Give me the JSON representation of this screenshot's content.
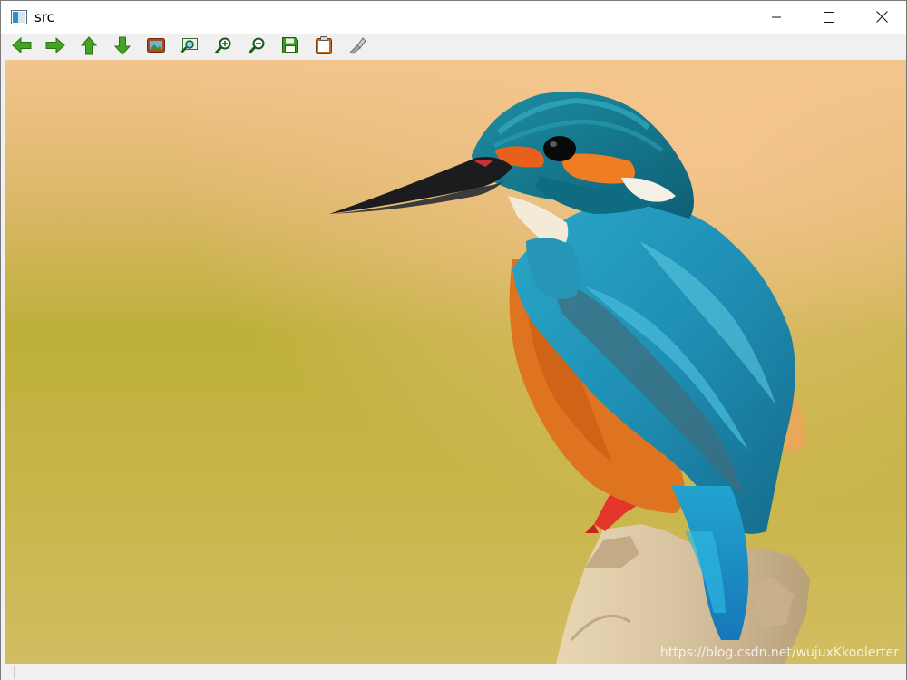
{
  "window": {
    "title": "src",
    "controls": {
      "minimize": "minimize-icon",
      "maximize": "maximize-icon",
      "close": "close-icon"
    }
  },
  "toolbar": {
    "buttons": [
      {
        "icon": "arrow-left-icon"
      },
      {
        "icon": "arrow-right-icon"
      },
      {
        "icon": "arrow-up-icon"
      },
      {
        "icon": "arrow-down-icon"
      },
      {
        "icon": "image-icon"
      },
      {
        "icon": "zoom-fit-icon"
      },
      {
        "icon": "zoom-in-icon"
      },
      {
        "icon": "zoom-out-icon"
      },
      {
        "icon": "save-icon"
      },
      {
        "icon": "clipboard-icon"
      },
      {
        "icon": "properties-icon"
      }
    ]
  },
  "image": {
    "subject": "kingfisher-photo",
    "watermark": "https://blog.csdn.net/wujuxKkoolerter"
  },
  "colors": {
    "titlebar": "#ffffff",
    "toolbar": "#f0f0f0",
    "arrow_green": "#3f9a1f",
    "bg_top": "#f2c48c",
    "bg_mid": "#b9ae33",
    "bg_bottom": "#d0bc5f"
  }
}
